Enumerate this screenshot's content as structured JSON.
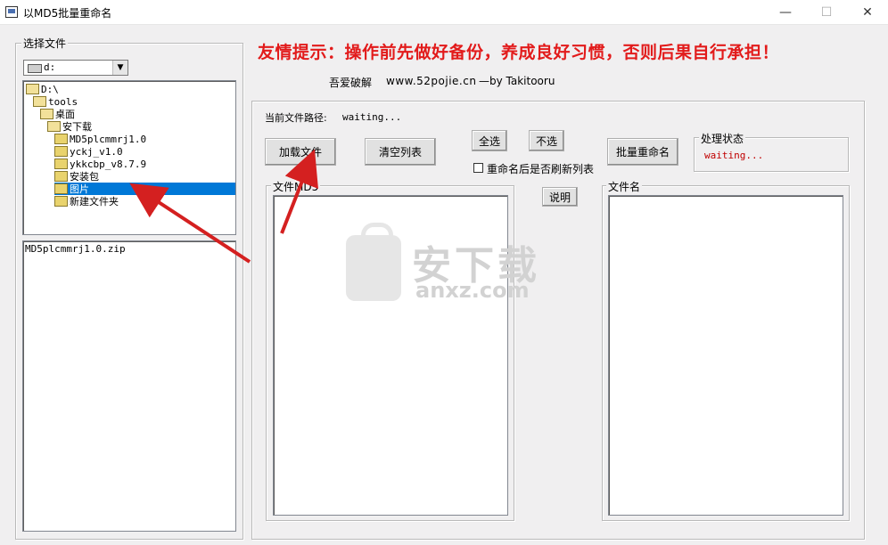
{
  "window": {
    "title": "以MD5批量重命名",
    "minimize_glyph": "—",
    "maximize_glyph": "☐",
    "close_glyph": "✕"
  },
  "left_panel": {
    "legend": "选择文件",
    "drive": {
      "value": "d:",
      "icon": "drive-icon"
    },
    "tree": [
      {
        "label": "D:\\",
        "indent": 0,
        "selected": false
      },
      {
        "label": "tools",
        "indent": 1,
        "selected": false
      },
      {
        "label": "桌面",
        "indent": 2,
        "selected": false
      },
      {
        "label": "安下载",
        "indent": 3,
        "selected": false
      },
      {
        "label": "MD5plcmmrj1.0",
        "indent": 4,
        "selected": false
      },
      {
        "label": "yckj_v1.0",
        "indent": 4,
        "selected": false
      },
      {
        "label": "ykkcbp_v8.7.9",
        "indent": 4,
        "selected": false
      },
      {
        "label": "安装包",
        "indent": 4,
        "selected": false
      },
      {
        "label": "图片",
        "indent": 4,
        "selected": true
      },
      {
        "label": "新建文件夹",
        "indent": 4,
        "selected": false
      }
    ],
    "files": [
      "MD5plcmmrj1.0.zip"
    ]
  },
  "header": {
    "warning": "友情提示：操作前先做好备份，养成良好习惯，否则后果自行承担！",
    "credit_site": "吾爱破解",
    "credit_url": "www.52pojie.cn",
    "credit_author": "—by Takitooru"
  },
  "main": {
    "path_label": "当前文件路径:",
    "path_value": "waiting...",
    "buttons": {
      "load": "加载文件",
      "clear": "清空列表",
      "select_all": "全选",
      "select_none": "不选",
      "batch_rename": "批量重命名",
      "help": "说明"
    },
    "refresh_checkbox": {
      "label": "重命名后是否刷新列表",
      "checked": false
    },
    "status": {
      "legend": "处理状态",
      "value": "waiting...",
      "color": "#c00000"
    },
    "md5_list": {
      "legend": "文件MD5",
      "items": []
    },
    "name_list": {
      "legend": "文件名",
      "items": []
    }
  },
  "watermark": {
    "text_cn": "安下载",
    "text_en": "anxz.com"
  },
  "colors": {
    "warning": "#e21b1b",
    "selection": "#0078d7",
    "annotation_arrow": "#d42020"
  }
}
